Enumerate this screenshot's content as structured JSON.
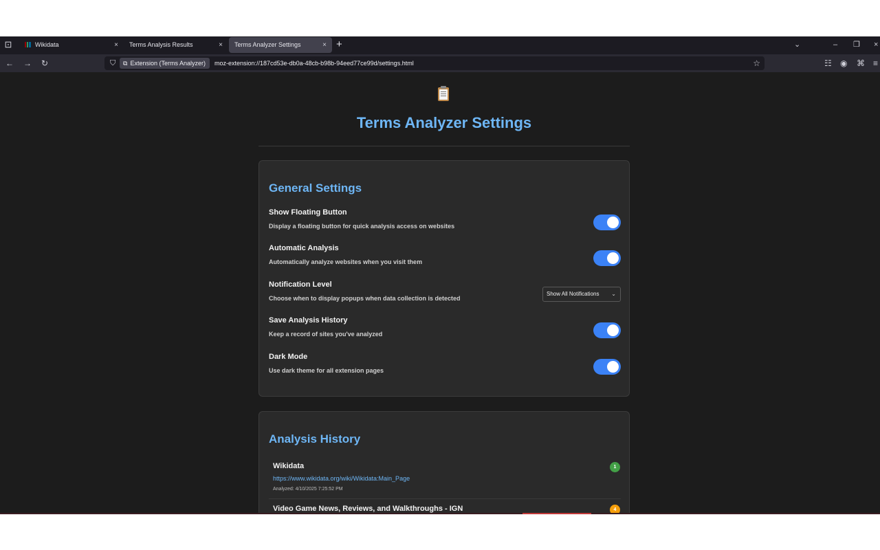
{
  "browser": {
    "tab_list_icon": "tab-list-icon",
    "tabs": [
      {
        "title": "Wikidata",
        "close": "×",
        "active": false,
        "favicon": "wikidata-icon"
      },
      {
        "title": "Terms Analysis Results",
        "close": "×",
        "active": false
      },
      {
        "title": "Terms Analyzer Settings",
        "close": "×",
        "active": true
      }
    ],
    "new_tab": "+",
    "window_controls": {
      "list": "⌄",
      "minimize": "–",
      "restore": "❐",
      "close": "×"
    },
    "nav": {
      "back": "←",
      "forward": "→",
      "reload": "↻"
    },
    "url_bar": {
      "shield": "⛉",
      "extension_chip": "Extension (Terms Analyzer)",
      "url": "moz-extension://187cd53e-db0a-48cb-b98b-94eed77ce99d/settings.html",
      "star": "☆"
    },
    "toolbar": {
      "pocket": "☷",
      "account": "◉",
      "extensions": "⌘",
      "menu": "≡"
    }
  },
  "page": {
    "header_icon": "clipboard-icon",
    "title": "Terms Analyzer Settings",
    "general": {
      "title": "General Settings",
      "settings": [
        {
          "label": "Show Floating Button",
          "desc": "Display a floating button for quick analysis access on websites",
          "control": "toggle",
          "on": true
        },
        {
          "label": "Automatic Analysis",
          "desc": "Automatically analyze websites when you visit them",
          "control": "toggle",
          "on": true
        },
        {
          "label": "Notification Level",
          "desc": "Choose when to display popups when data collection is detected",
          "control": "select",
          "value": "Show All Notifications"
        },
        {
          "label": "Save Analysis History",
          "desc": "Keep a record of sites you've analyzed",
          "control": "toggle",
          "on": true
        },
        {
          "label": "Dark Mode",
          "desc": "Use dark theme for all extension pages",
          "control": "toggle",
          "on": true
        }
      ]
    },
    "history": {
      "title": "Analysis History",
      "items": [
        {
          "site": "Wikidata",
          "url": "https://www.wikidata.org/wiki/Wikidata:Main_Page",
          "date": "Analyzed: 4/10/2025 7:25:52 PM",
          "badge": "1",
          "badge_color": "#43a047"
        },
        {
          "site": "Video Game News, Reviews, and Walkthroughs - IGN",
          "url": "",
          "date": "",
          "badge": "4",
          "badge_color": "#f59e0b"
        }
      ]
    }
  },
  "colors": {
    "accent": "#6eb6f5",
    "toggle_on": "#3b82f6",
    "card_bg": "#2a2a2a"
  }
}
